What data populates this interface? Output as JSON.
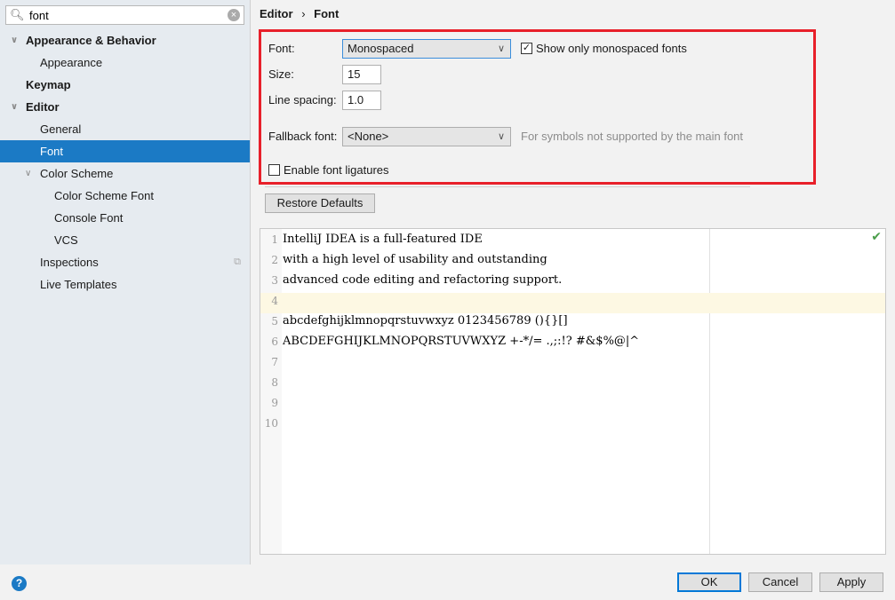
{
  "search": {
    "value": "font",
    "placeholder": ""
  },
  "tree": [
    {
      "label": "Appearance & Behavior",
      "bold": true,
      "expanded": true,
      "level": 0
    },
    {
      "label": "Appearance",
      "level": 1
    },
    {
      "label": "Keymap",
      "bold": true,
      "level": 0
    },
    {
      "label": "Editor",
      "bold": true,
      "expanded": true,
      "level": 0
    },
    {
      "label": "General",
      "level": 1
    },
    {
      "label": "Font",
      "level": 1,
      "selected": true
    },
    {
      "label": "Color Scheme",
      "level": 1,
      "expanded": true
    },
    {
      "label": "Color Scheme Font",
      "level": 2
    },
    {
      "label": "Console Font",
      "level": 2
    },
    {
      "label": "VCS",
      "level": 2
    },
    {
      "label": "Inspections",
      "level": 1,
      "copy_icon": true
    },
    {
      "label": "Live Templates",
      "level": 1
    }
  ],
  "breadcrumb": {
    "parent": "Editor",
    "sep": "›",
    "current": "Font"
  },
  "form": {
    "font_label": "Font:",
    "font_value": "Monospaced",
    "show_mono_label": "Show only monospaced fonts",
    "show_mono_checked": true,
    "size_label": "Size:",
    "size_value": "15",
    "spacing_label": "Line spacing:",
    "spacing_value": "1.0",
    "fallback_label": "Fallback font:",
    "fallback_value": "<None>",
    "fallback_hint": "For symbols not supported by the main font",
    "ligatures_label": "Enable font ligatures",
    "ligatures_checked": false
  },
  "restore_label": "Restore Defaults",
  "preview": {
    "highlighted_line": 4,
    "lines": [
      "IntelliJ IDEA is a full-featured IDE",
      "with a high level of usability and outstanding",
      "advanced code editing and refactoring support.",
      "",
      "abcdefghijklmnopqrstuvwxyz 0123456789 (){}[]",
      "ABCDEFGHIJKLMNOPQRSTUVWXYZ +-*/= .,;:!? #&$%@|^",
      "",
      "",
      "",
      ""
    ]
  },
  "buttons": {
    "ok": "OK",
    "cancel": "Cancel",
    "apply": "Apply",
    "help": "?"
  },
  "colors": {
    "selection": "#1b7ac5",
    "highlight_box": "#e8202a",
    "current_line": "#fdf8e3"
  }
}
